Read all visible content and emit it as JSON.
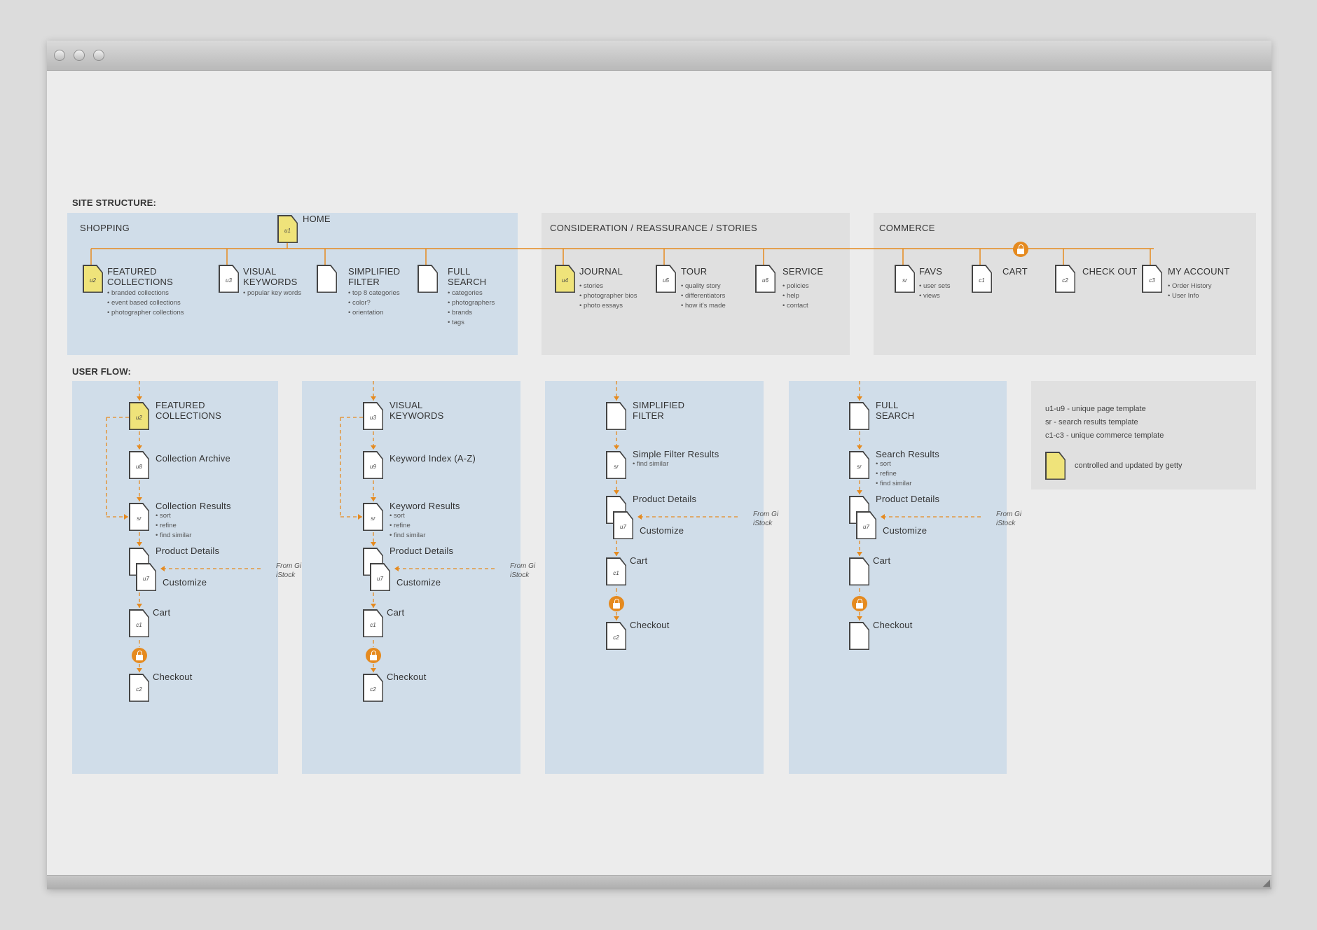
{
  "site_structure_label": "SITE STRUCTURE:",
  "user_flow_label": "USER FLOW:",
  "groups": {
    "shopping": "SHOPPING",
    "consideration": "CONSIDERATION / REASSURANCE / STORIES",
    "commerce": "COMMERCE"
  },
  "home": {
    "label": "HOME",
    "code": "u1"
  },
  "structure_nodes": [
    {
      "code": "u2",
      "label": "FEATURED\nCOLLECTIONS",
      "items": [
        "branded collections",
        "event based collections",
        "photographer collections"
      ],
      "yellow": true
    },
    {
      "code": "u3",
      "label": "VISUAL\nKEYWORDS",
      "items": [
        "popular key words"
      ],
      "yellow": false
    },
    {
      "code": "",
      "label": "SIMPLIFIED\nFILTER",
      "items": [
        "top 8 categories",
        "color?",
        "orientation"
      ],
      "yellow": false
    },
    {
      "code": "",
      "label": "FULL\nSEARCH",
      "items": [
        "categories",
        "photographers",
        "brands",
        "tags"
      ],
      "yellow": false
    },
    {
      "code": "u4",
      "label": "JOURNAL",
      "items": [
        "stories",
        "photographer bios",
        "photo essays"
      ],
      "yellow": true
    },
    {
      "code": "u5",
      "label": "TOUR",
      "items": [
        "quality story",
        "differentiators",
        "how it's made"
      ],
      "yellow": false
    },
    {
      "code": "u6",
      "label": "SERVICE",
      "items": [
        "policies",
        "help",
        "contact"
      ],
      "yellow": false
    },
    {
      "code": "sr",
      "label": "FAVS",
      "items": [
        "user sets",
        "views"
      ],
      "yellow": false
    },
    {
      "code": "c1",
      "label": "CART",
      "items": [],
      "yellow": false
    },
    {
      "code": "c2",
      "label": "CHECK OUT",
      "items": [],
      "yellow": false
    },
    {
      "code": "c3",
      "label": "MY ACCOUNT",
      "items": [
        "Order History",
        "User Info"
      ],
      "yellow": false
    }
  ],
  "flows": [
    {
      "title": {
        "code": "u2",
        "label": "FEATURED\nCOLLECTIONS",
        "yellow": true
      },
      "step2": {
        "code": "u8",
        "label": "Collection Archive",
        "items": []
      },
      "results": {
        "code": "sr",
        "label": "Collection Results",
        "items": [
          "sort",
          "refine",
          "find similar"
        ]
      },
      "product": "Product Details",
      "customize": {
        "code": "u7",
        "label": "Customize"
      },
      "from": "From Gi\niStock",
      "cart": {
        "code": "c1",
        "label": "Cart"
      },
      "checkout": {
        "code": "c2",
        "label": "Checkout"
      }
    },
    {
      "title": {
        "code": "u3",
        "label": "VISUAL\nKEYWORDS",
        "yellow": false
      },
      "step2": {
        "code": "u9",
        "label": "Keyword Index (A-Z)",
        "items": []
      },
      "results": {
        "code": "sr",
        "label": "Keyword Results",
        "items": [
          "sort",
          "refine",
          "find similar"
        ]
      },
      "product": "Product Details",
      "customize": {
        "code": "u7",
        "label": "Customize"
      },
      "from": "From Gi\niStock",
      "cart": {
        "code": "c1",
        "label": "Cart"
      },
      "checkout": {
        "code": "c2",
        "label": "Checkout"
      }
    },
    {
      "title": {
        "code": "",
        "label": "SIMPLIFIED\nFILTER",
        "yellow": false
      },
      "results": {
        "code": "sr",
        "label": "Simple Filter Results",
        "items": [
          "find similar"
        ]
      },
      "product": "Product Details",
      "customize": {
        "code": "u7",
        "label": "Customize"
      },
      "from": "From Gi\niStock",
      "cart": {
        "code": "c1",
        "label": "Cart"
      },
      "checkout": {
        "code": "c2",
        "label": "Checkout"
      }
    },
    {
      "title": {
        "code": "",
        "label": "FULL\nSEARCH",
        "yellow": false
      },
      "results": {
        "code": "sr",
        "label": "Search Results",
        "items": [
          "sort",
          "refine",
          "find similar"
        ]
      },
      "product": "Product Details",
      "customize": {
        "code": "u7",
        "label": "Customize"
      },
      "from": "From Gi\niStock",
      "cart": {
        "code": "",
        "label": "Cart"
      },
      "checkout": {
        "code": "",
        "label": "Checkout"
      }
    }
  ],
  "legend": {
    "lines": [
      "u1-u9 - unique page template",
      "sr - search results template",
      "c1-c3 - unique commerce template"
    ],
    "swatch_label": "controlled and updated by getty"
  },
  "colors": {
    "accent": "#e58a1f",
    "yellow": "#efe37a",
    "blue_panel": "#d0dde9",
    "grey_panel": "#e0e0e0"
  }
}
